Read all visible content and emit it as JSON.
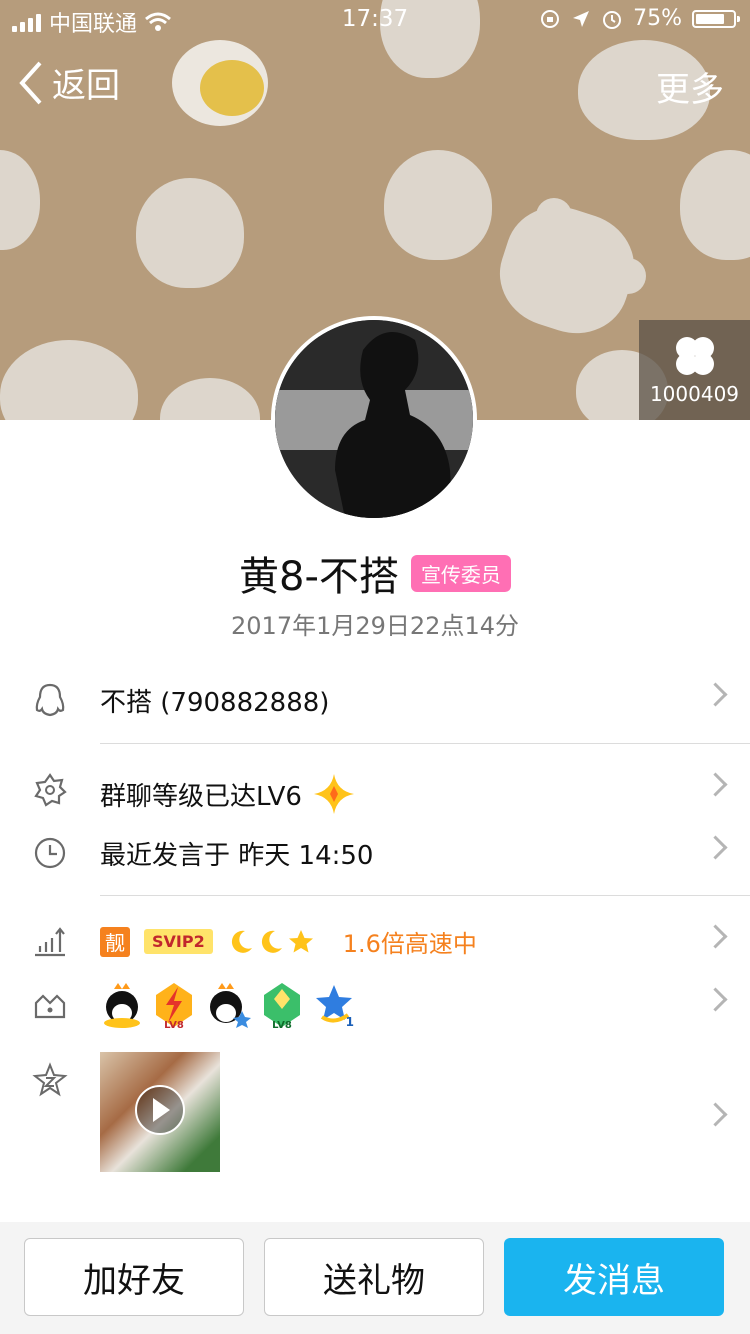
{
  "status": {
    "carrier": "中国联通",
    "time": "17:37",
    "battery": "75%"
  },
  "nav": {
    "back_label": "返回",
    "more_label": "更多"
  },
  "header": {
    "badge_number": "1000409"
  },
  "profile": {
    "name": "黄8-不搭",
    "title_tag": "宣传委员",
    "join_date": "2017年1月29日22点14分"
  },
  "info": {
    "qq": "不搭 (790882888)",
    "level": "群聊等级已达LV6",
    "last_speak": "最近发言于 昨天 14:50",
    "vip_tag": "靓",
    "svip_label": "SVIP2",
    "speed_text": "1.6倍高速中",
    "badge_lv1": "LV8",
    "badge_lv2": "LV8",
    "badge_count": "1"
  },
  "footer": {
    "add_friend": "加好友",
    "send_gift": "送礼物",
    "send_message": "发消息"
  },
  "colors": {
    "header_bg": "#b69c7c",
    "accent_blue": "#1ab4ef",
    "tag_pink": "#ff6fb4",
    "speed_orange": "#f5811e"
  }
}
